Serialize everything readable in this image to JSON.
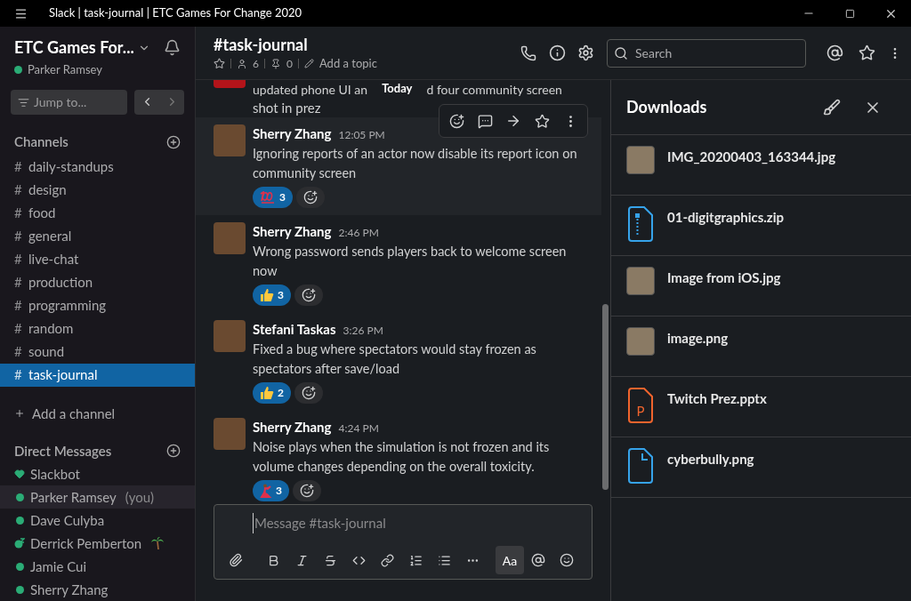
{
  "window": {
    "title": "Slack | task-journal | ETC Games For Change 2020"
  },
  "workspace": {
    "name": "ETC Games For...",
    "user": "Parker Ramsey",
    "jump_placeholder": "Jump to..."
  },
  "channels": {
    "title": "Channels",
    "items": [
      {
        "name": "daily-standups",
        "selected": false
      },
      {
        "name": "design",
        "selected": false
      },
      {
        "name": "food",
        "selected": false
      },
      {
        "name": "general",
        "selected": false
      },
      {
        "name": "live-chat",
        "selected": false
      },
      {
        "name": "production",
        "selected": false
      },
      {
        "name": "programming",
        "selected": false
      },
      {
        "name": "random",
        "selected": false
      },
      {
        "name": "sound",
        "selected": false
      },
      {
        "name": "task-journal",
        "selected": true
      }
    ],
    "hash": "#",
    "add": "Add a channel"
  },
  "direct_messages": {
    "title": "Direct Messages",
    "items": [
      {
        "name": "Slackbot",
        "kind": "bot",
        "selected": false
      },
      {
        "name": "Parker Ramsey",
        "note": "(you)",
        "kind": "online",
        "selected": true
      },
      {
        "name": "Dave Culyba",
        "kind": "online",
        "selected": false
      },
      {
        "name": "Derrick Pemberton",
        "kind": "away",
        "status": {
          "kind": "palm"
        },
        "selected": false
      },
      {
        "name": "Jamie Cui",
        "kind": "online",
        "selected": false
      },
      {
        "name": "Sherry Zhang",
        "kind": "online",
        "selected": false
      }
    ]
  },
  "header": {
    "channel": "#task-journal",
    "members": "6",
    "pins": "0",
    "topic": "Add a topic",
    "search_placeholder": "Search"
  },
  "partial_message": {
    "line_before": "updated phone UI an",
    "line_after": "d four community screen",
    "line_2": "shot in prez",
    "divider": "Today"
  },
  "messages": [
    {
      "author": "Sherry Zhang",
      "time": "12:05 PM",
      "text": "Ignoring reports of an actor now disable its report icon on community screen",
      "reaction": {
        "kind": "hundred",
        "count": "3"
      },
      "hovered": true
    },
    {
      "author": "Sherry Zhang",
      "time": "2:46 PM",
      "text": "Wrong password sends players back to welcome screen now",
      "reaction": {
        "kind": "thumbs",
        "count": "3"
      },
      "hovered": false
    },
    {
      "author": "Stefani Taskas",
      "time": "3:26 PM",
      "text": "Fixed a bug where spectators would stay frozen as spectators after save/load",
      "reaction": {
        "kind": "thumbs",
        "count": "2"
      },
      "hovered": false
    },
    {
      "author": "Sherry Zhang",
      "time": "4:24 PM",
      "text": "Noise plays when the simulation is not frozen and its volume changes depending on the overall toxicity.",
      "reaction": {
        "kind": "dancer",
        "count": "3"
      },
      "hovered": false
    }
  ],
  "composer": {
    "placeholder": "Message #task-journal",
    "format_button": "Aa"
  },
  "downloads": {
    "title": "Downloads",
    "items": [
      {
        "name": "IMG_20200403_163344.jpg",
        "kind": "photo"
      },
      {
        "name": "01-digitgraphics.zip",
        "kind": "zip"
      },
      {
        "name": "Image from iOS.jpg",
        "kind": "photo"
      },
      {
        "name": "image.png",
        "kind": "photo"
      },
      {
        "name": "Twitch Prez.pptx",
        "kind": "slides",
        "letter": "P"
      },
      {
        "name": "cyberbully.png",
        "kind": "file"
      }
    ]
  }
}
